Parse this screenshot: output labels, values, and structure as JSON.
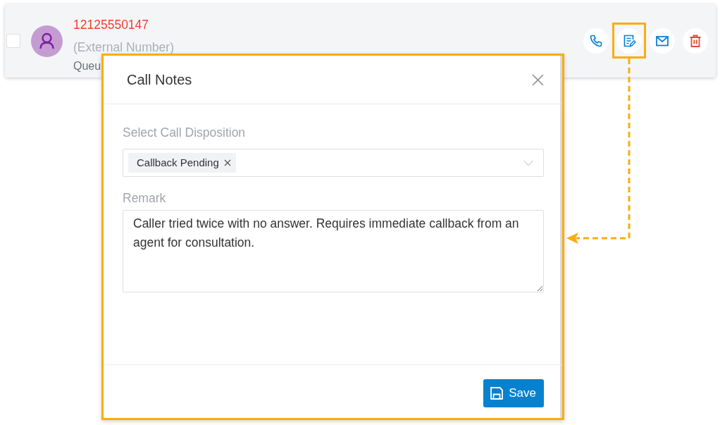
{
  "contact": {
    "checked": false,
    "number": "12125550147",
    "number_type": "(External Number)",
    "line_3": "Queu"
  },
  "actions": [
    {
      "kind": "call",
      "highlighted": false
    },
    {
      "kind": "notes",
      "highlighted": true
    },
    {
      "kind": "email",
      "highlighted": false
    },
    {
      "kind": "delete",
      "highlighted": false
    }
  ],
  "dialog": {
    "title": "Call Notes",
    "highlighted": true,
    "disposition": {
      "label": "Select Call Disposition",
      "tags": [
        "Callback Pending"
      ]
    },
    "remark": {
      "label": "Remark",
      "value": "Caller tried twice with no answer. Requires immediate callback from an agent for consultation."
    },
    "buttons": [
      {
        "label": "Save",
        "kind": "primary"
      }
    ]
  }
}
